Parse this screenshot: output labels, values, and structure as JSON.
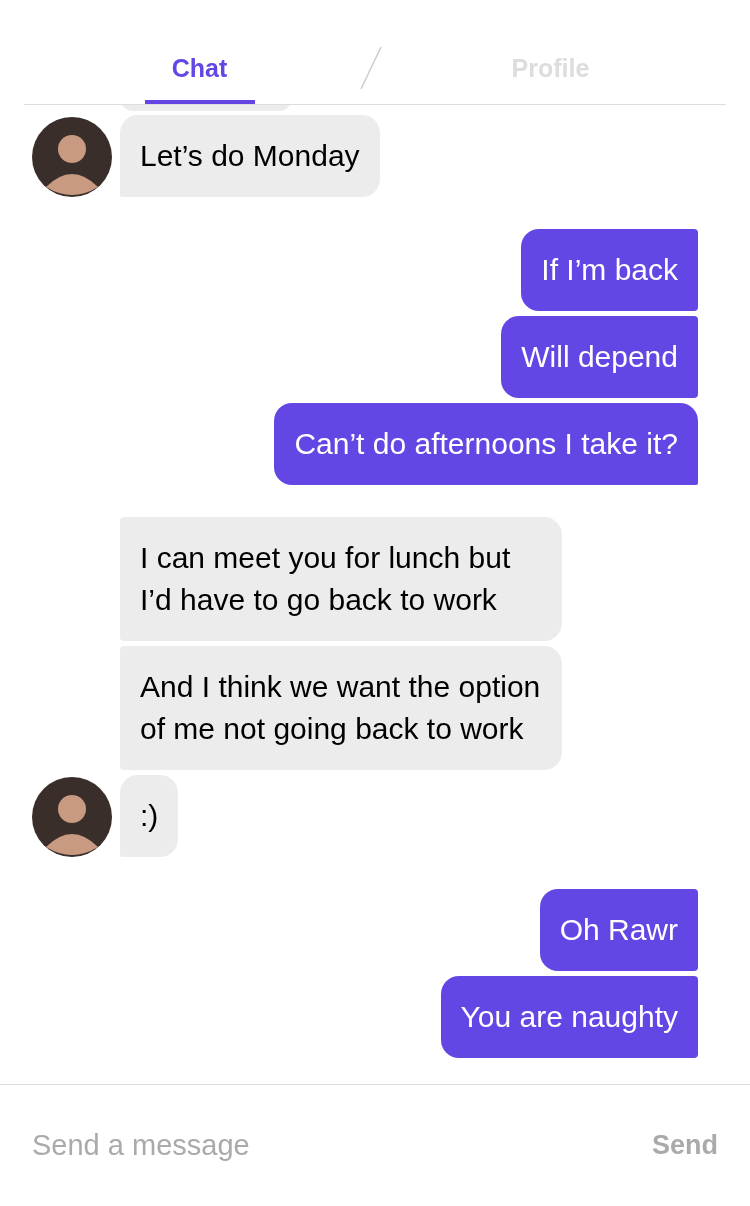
{
  "tabs": [
    {
      "label": "Chat",
      "selected": true
    },
    {
      "label": "Profile",
      "selected": false
    }
  ],
  "messages": [
    {
      "kind": "incoming",
      "text": "Let’s do Monday",
      "avatar": true,
      "tail": true
    },
    {
      "kind": "outgoing",
      "text": "If I’m back",
      "tail": false
    },
    {
      "kind": "outgoing",
      "text": "Will depend",
      "tail": false
    },
    {
      "kind": "outgoing",
      "text": "Can’t do afternoons I take it?",
      "tail": true
    },
    {
      "kind": "incoming",
      "text": "I can meet you for lunch but I’d have to go back to work",
      "avatar": false,
      "tail": false
    },
    {
      "kind": "incoming",
      "text": "And I think we want the option of me not going back to work",
      "avatar": false,
      "tail": false
    },
    {
      "kind": "incoming",
      "text": ":)",
      "avatar": true,
      "tail": true
    },
    {
      "kind": "outgoing",
      "text": "Oh Rawr",
      "tail": false
    },
    {
      "kind": "outgoing",
      "text": "You are naughty",
      "tail": false
    }
  ],
  "composer": {
    "placeholder": "Send a message",
    "send": "Send"
  }
}
